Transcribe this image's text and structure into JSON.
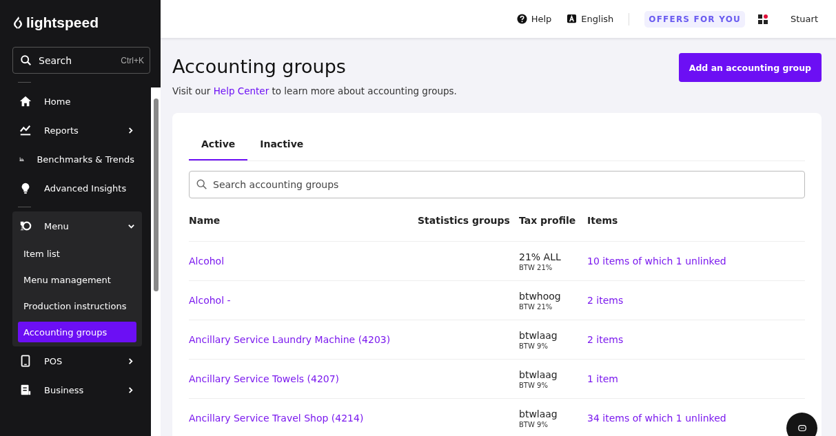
{
  "sidebar": {
    "logo": "lightspeed",
    "search": {
      "placeholder": "Search",
      "shortcut": "Ctrl+K"
    },
    "items": [
      {
        "label": "Home",
        "expandable": false,
        "expanded": false
      },
      {
        "label": "Reports",
        "expandable": true,
        "expanded": false
      },
      {
        "label": "Benchmarks & Trends",
        "expandable": false,
        "expanded": false
      },
      {
        "label": "Advanced Insights",
        "expandable": false,
        "expanded": false
      },
      {
        "label": "Menu",
        "expandable": true,
        "expanded": true,
        "children": [
          {
            "label": "Item list",
            "selected": false
          },
          {
            "label": "Menu management",
            "selected": false
          },
          {
            "label": "Production instructions",
            "selected": false
          },
          {
            "label": "Accounting groups",
            "selected": true
          }
        ]
      },
      {
        "label": "POS",
        "expandable": true,
        "expanded": false
      },
      {
        "label": "Business",
        "expandable": true,
        "expanded": false
      }
    ]
  },
  "topbar": {
    "help": "Help",
    "language": "English",
    "offers": "OFFERS FOR YOU",
    "user": "Stuart"
  },
  "page": {
    "title": "Accounting groups",
    "intro_before": "Visit our ",
    "intro_link": "Help Center",
    "intro_after": " to learn more about accounting groups.",
    "add_button": "Add an accounting group"
  },
  "tabs": [
    {
      "label": "Active",
      "selected": true
    },
    {
      "label": "Inactive",
      "selected": false
    }
  ],
  "search": {
    "placeholder": "Search accounting groups"
  },
  "table": {
    "columns": [
      "Name",
      "Statistics groups",
      "Tax profile",
      "Items"
    ],
    "rows": [
      {
        "name": "Alcohol",
        "tax_profile": "21% ALL",
        "tax_rate": "BTW 21%",
        "items": "10 items of which 1 unlinked"
      },
      {
        "name": "Alcohol -",
        "tax_profile": "btwhoog",
        "tax_rate": "BTW 21%",
        "items": "2 items"
      },
      {
        "name": "Ancillary Service Laundry Machine (4203)",
        "tax_profile": "btwlaag",
        "tax_rate": "BTW 9%",
        "items": "2 items"
      },
      {
        "name": "Ancillary Service Towels (4207)",
        "tax_profile": "btwlaag",
        "tax_rate": "BTW 9%",
        "items": "1 item"
      },
      {
        "name": "Ancillary Service Travel Shop (4214)",
        "tax_profile": "btwlaag",
        "tax_rate": "BTW 9%",
        "items": "34 items of which 1 unlinked"
      }
    ]
  }
}
